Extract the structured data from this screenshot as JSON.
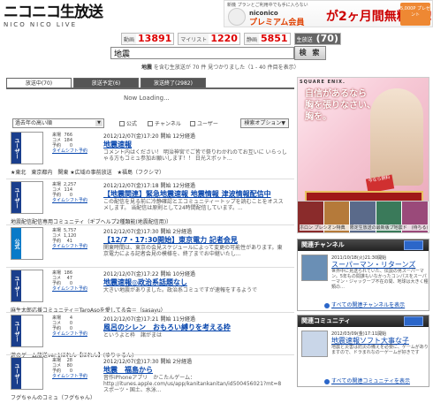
{
  "header": {
    "logo_main": "ニコニコ生放送",
    "logo_sub": "NICO NICO LIVE"
  },
  "banner": {
    "small": "新機 プランとご利用中でも手に入らない",
    "brand": "niconico",
    "premium": "プレミアム会員",
    "headline": "が2ヶ月間無料に!!",
    "badge": "5,000P プレゼント"
  },
  "stats": [
    {
      "label": "動画",
      "value": "13891"
    },
    {
      "label": "マイリスト",
      "value": "1220"
    },
    {
      "label": "静画",
      "value": "5851"
    },
    {
      "label": "生放送",
      "value": "(70)"
    }
  ],
  "search": {
    "query": "地震",
    "button": "検 索",
    "result_prefix": "地震",
    "result_rest": " を含む生放送が 70 件 見つかりました（1 - 40 件目を表示）"
  },
  "tabs": [
    {
      "label": "放送中(70)"
    },
    {
      "label": "放送予定(6)"
    },
    {
      "label": "放送終了(2982)"
    }
  ],
  "loading": "Now Loading...",
  "filters": {
    "sort": "過去年の高い順",
    "checks": [
      "公式",
      "チャンネル",
      "ユーザー"
    ],
    "option": "検索オプション▼"
  },
  "results": [
    {
      "side": "ユーザー",
      "visitors": "766",
      "comments": "184",
      "reserve": "0",
      "timeslip": "タイムシフト予約",
      "when": "2012/12/07(金)17:20 開始 12分経過",
      "title": "地震速報",
      "desc": "コメント内はください！ 明治神宮でご皆で祭りわかれのてお互いに いらっしゃる方もコミュ参加お願いします！！ 日光スポット...",
      "community": "★東北　東京都内　関東 ★広域の事前放送　★福島（フクシマ）"
    },
    {
      "side": "ユーザー",
      "visitors": "2,257",
      "comments": "114",
      "reserve": "0",
      "timeslip": "タイムシフト予約",
      "when": "2012/12/07(金)17:18 開始 12分経過",
      "title": "【地震関連】緊急地震速報 地震情報 津波情報配信中",
      "desc": "この配信を見る前に冷静確認とエコミュニティートップを読むことをオススメします。 当配信は原則として24時間配信しています。...",
      "community": "地震配信配信専用コミュニティ（ギブヘルプ2種類能(地震配信用)）"
    },
    {
      "side": "公式",
      "visitors": "5,757",
      "comments": "1,120",
      "reserve": "41",
      "timeslip": "タイムシフト予約",
      "when": "2012/12/07(金)17:30 開始 2分経過",
      "title": "【12/7・17:30開始】東京電力 記者会見",
      "desc": "関東時間は、東京の会見スケジュールによって変更の可能性があります。東京電力による記者会見の模様を、終了までお中継いたし...",
      "community": ""
    },
    {
      "side": "ユーザー",
      "visitors": "186",
      "comments": "47",
      "reserve": "0",
      "timeslip": "タイムシフト予約",
      "when": "2012/12/07(金)17:22 開始 10分経過",
      "title": "地震速報◎政治系話題なし",
      "desc": "大きい地震がありました。政治系コミュですが速報をするようで",
      "community": "麻生太郎応援コミュニティ＝TaroAsoを愛してる会＝（sasayu）"
    },
    {
      "side": "ユーザー",
      "visitors": "4",
      "comments": "0",
      "reserve": "0",
      "timeslip": "タイムシフト予約",
      "when": "2012/12/07(金)17:21 開始 11分経過",
      "title": "風呂のシレン　おもろい縛りを考える枠",
      "desc": "というよと枠　諸がまは",
      "community": "遊のゲーム放送ver.1ほれん【ほれん】(ゆりゃるん)"
    },
    {
      "side": "ユーザー",
      "visitors": "28",
      "comments": "80",
      "reserve": "0",
      "timeslip": "タイムシフト予約",
      "when": "2012/12/07(金)17:30 開始 2分経過",
      "title": "地震　福島から",
      "desc": "音作iPhoneアプリ　かこたんゲーム：http://itunes.apple.com/us/app/kanitankanitan/id500456021?mt=8 スポーツ・国土、水泳...",
      "community": "フグちゃんのコミュ（フグちゃん）"
    }
  ],
  "ad": {
    "maker": "SQUARE ENIX.",
    "copy1": "自信があるなら",
    "copy2": "胸を張りなさい、",
    "copy3": "胸を。",
    "ribbon": "今なら無料",
    "game": "CRYSTAL CONQUEST",
    "strip": "ホロン プレシオン特典　限定生放送の最新版プ地震ド　(待ちる)"
  },
  "channel_box": {
    "title": "関連チャンネル",
    "date": "2011/10/18(火)21:30開始",
    "item_title": "スーパーマン・リターンズ",
    "desc": "世界中に見送られていた、伝説の男スーパーマン。5年もの間誰もいなかったコンパスをスーパーマン・ジャックーブ不在の間、地球は大きく種類の…",
    "more": "すべての関連チャンネルを表示"
  },
  "community_box": {
    "title": "関連コミュニティ",
    "date": "2012/03/09(金)17:11開始",
    "item_title": "地震速報ソフト大事な子",
    "desc": "地震と災害は防災の備えを必要に、ゲームがありますので、ドラまれなの一ゲームが好きです",
    "more": "すべての関連コミュニティを表示"
  },
  "colors": {
    "accent_red": "#dd0000",
    "link": "#0645ad",
    "tab_dark": "#555555",
    "user_badge": "#1a3e8c"
  }
}
